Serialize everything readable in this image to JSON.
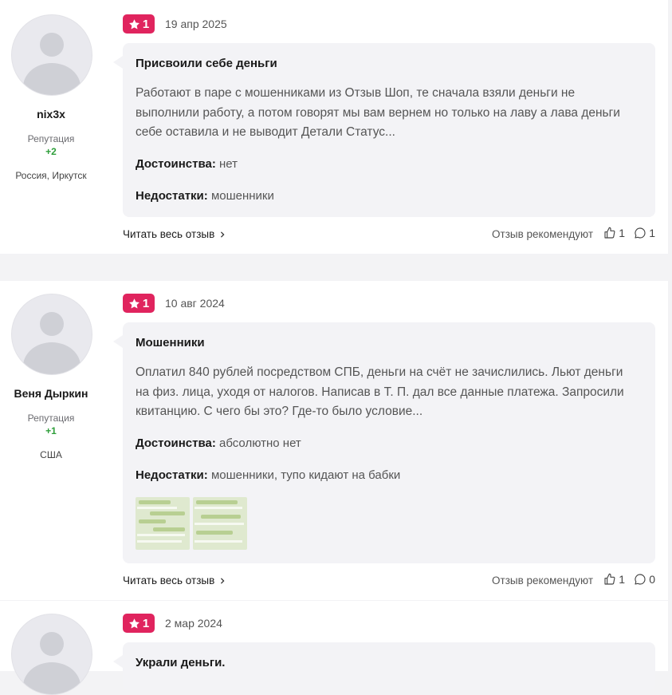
{
  "common": {
    "reputation_label": "Репутация",
    "read_more": "Читать весь отзыв",
    "recommend_label": "Отзыв рекомендуют",
    "pros_label": "Достоинства:",
    "cons_label": "Недостатки:",
    "accent_color": "#e0245e"
  },
  "reviews": [
    {
      "user": "nix3x",
      "reputation": "+2",
      "location": "Россия, Иркутск",
      "rating": "1",
      "date": "19 апр 2025",
      "title": "Присвоили себе деньги",
      "text": "Работают в паре с мошенниками из Отзыв Шоп, те сначала взяли деньги не выполнили работу, а потом говорят мы вам вернем но только на лаву а лава деньги себе оставила и не выводит Детали Статус...",
      "pros": "нет",
      "cons": "мошенники",
      "likes": "1",
      "comments": "1"
    },
    {
      "user": "Веня Дыркин",
      "reputation": "+1",
      "location": "США",
      "rating": "1",
      "date": "10 авг 2024",
      "title": "Мошенники",
      "text": "Оплатил 840 рублей посредством СПБ, деньги на счёт не зачислились. Льют деньги на физ. лица, уходя от налогов. Написав в Т. П. дал все данные платежа. Запросили квитанцию. С чего бы это? Где-то было условие...",
      "pros": "абсолютно нет",
      "cons": "мошенники, тупо кидают на бабки",
      "likes": "1",
      "comments": "0"
    },
    {
      "rating": "1",
      "date": "2 мар 2024",
      "title": "Украли деньги."
    }
  ]
}
